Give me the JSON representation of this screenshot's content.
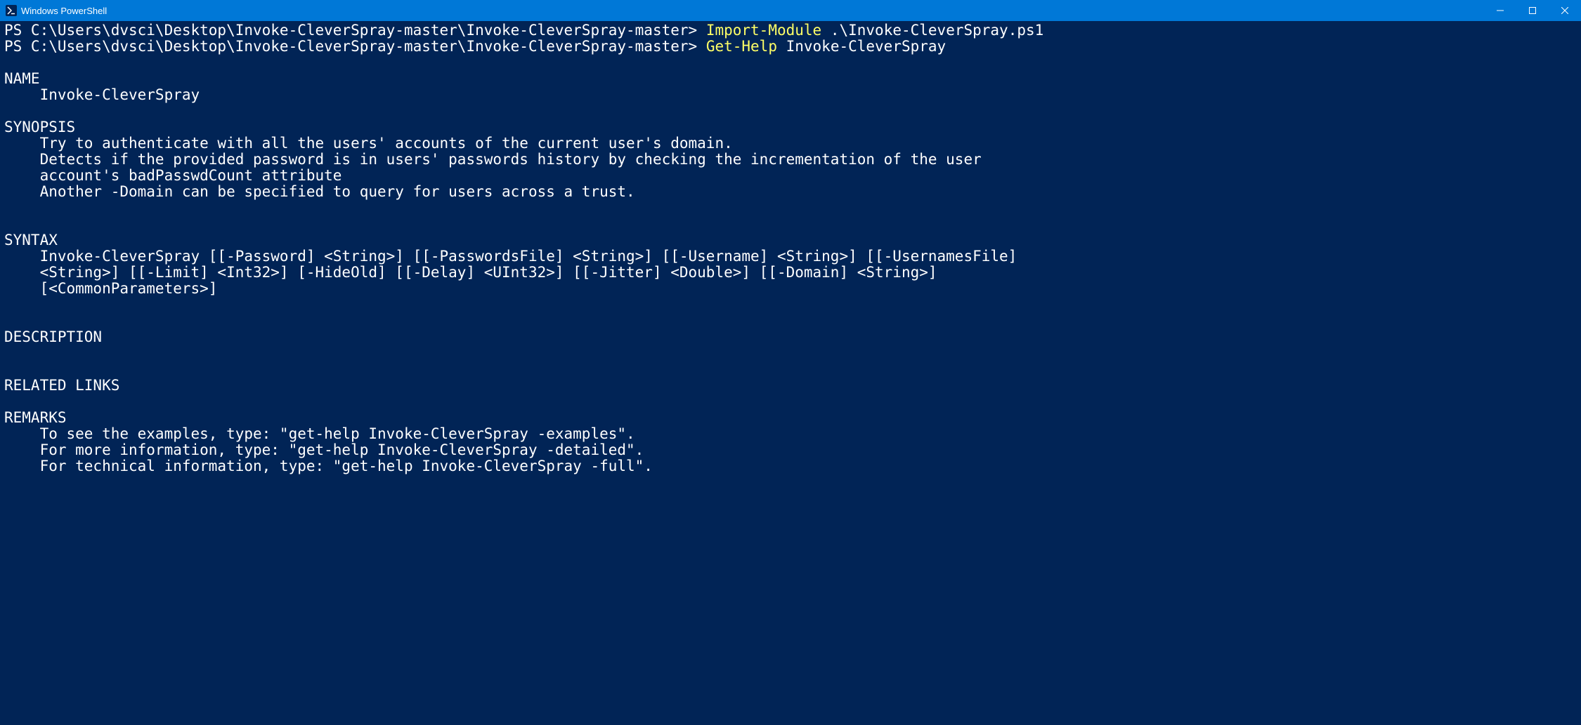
{
  "window": {
    "title": "Windows PowerShell"
  },
  "lines": {
    "l1_prompt": "PS C:\\Users\\dvsci\\Desktop\\Invoke-CleverSpray-master\\Invoke-CleverSpray-master> ",
    "l1_cmd": "Import-Module",
    "l1_arg": " .\\Invoke-CleverSpray.ps1",
    "l2_prompt": "PS C:\\Users\\dvsci\\Desktop\\Invoke-CleverSpray-master\\Invoke-CleverSpray-master> ",
    "l2_cmd": "Get-Help",
    "l2_arg": " Invoke-CleverSpray",
    "h_name": "NAME",
    "name_val": "    Invoke-CleverSpray",
    "h_synopsis": "SYNOPSIS",
    "syn1": "    Try to authenticate with all the users' accounts of the current user's domain.",
    "syn2": "    Detects if the provided password is in users' passwords history by checking the incrementation of the user",
    "syn3": "    account's badPasswdCount attribute",
    "syn4": "    Another -Domain can be specified to query for users across a trust.",
    "h_syntax": "SYNTAX",
    "stx1": "    Invoke-CleverSpray [[-Password] <String>] [[-PasswordsFile] <String>] [[-Username] <String>] [[-UsernamesFile]",
    "stx2": "    <String>] [[-Limit] <Int32>] [-HideOld] [[-Delay] <UInt32>] [[-Jitter] <Double>] [[-Domain] <String>]",
    "stx3": "    [<CommonParameters>]",
    "h_description": "DESCRIPTION",
    "h_related": "RELATED LINKS",
    "h_remarks": "REMARKS",
    "rem1": "    To see the examples, type: \"get-help Invoke-CleverSpray -examples\".",
    "rem2": "    For more information, type: \"get-help Invoke-CleverSpray -detailed\".",
    "rem3": "    For technical information, type: \"get-help Invoke-CleverSpray -full\"."
  }
}
